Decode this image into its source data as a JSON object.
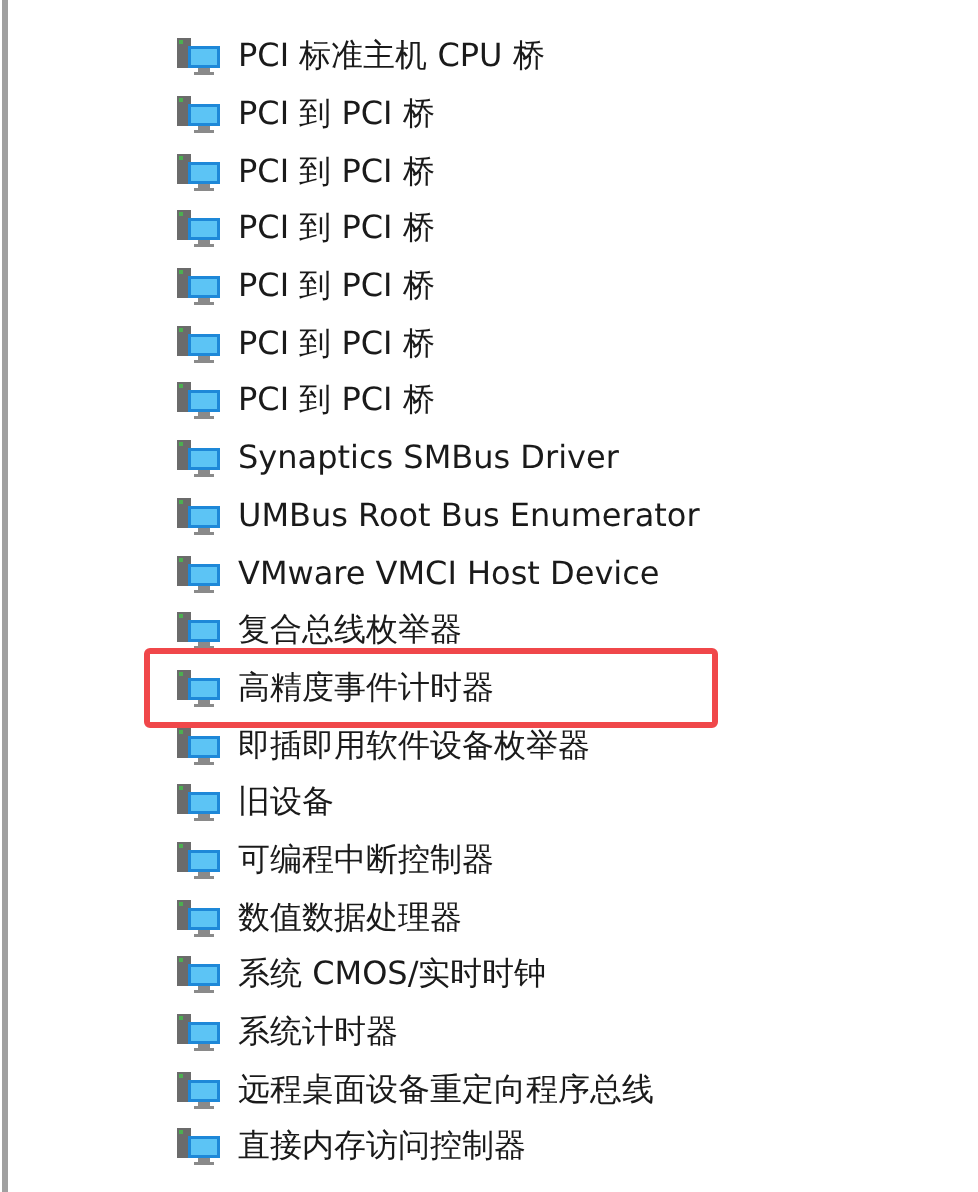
{
  "devices": [
    {
      "label": "PCI 标准主机 CPU 桥",
      "selected": false
    },
    {
      "label": "PCI 到 PCI 桥",
      "selected": false
    },
    {
      "label": "PCI 到 PCI 桥",
      "selected": false
    },
    {
      "label": "PCI 到 PCI 桥",
      "selected": false
    },
    {
      "label": "PCI 到 PCI 桥",
      "selected": false
    },
    {
      "label": "PCI 到 PCI 桥",
      "selected": false
    },
    {
      "label": "PCI 到 PCI 桥",
      "selected": false
    },
    {
      "label": "Synaptics SMBus Driver",
      "selected": false
    },
    {
      "label": "UMBus Root Bus Enumerator",
      "selected": false
    },
    {
      "label": "VMware VMCI Host Device",
      "selected": false
    },
    {
      "label": "复合总线枚举器",
      "selected": false
    },
    {
      "label": "高精度事件计时器",
      "selected": true
    },
    {
      "label": "即插即用软件设备枚举器",
      "selected": false
    },
    {
      "label": "旧设备",
      "selected": false
    },
    {
      "label": "可编程中断控制器",
      "selected": false
    },
    {
      "label": "数值数据处理器",
      "selected": false
    },
    {
      "label": "系统 CMOS/实时时钟",
      "selected": false
    },
    {
      "label": "系统计时器",
      "selected": false
    },
    {
      "label": "远程桌面设备重定向程序总线",
      "selected": false
    },
    {
      "label": "直接内存访问控制器",
      "selected": false
    }
  ]
}
